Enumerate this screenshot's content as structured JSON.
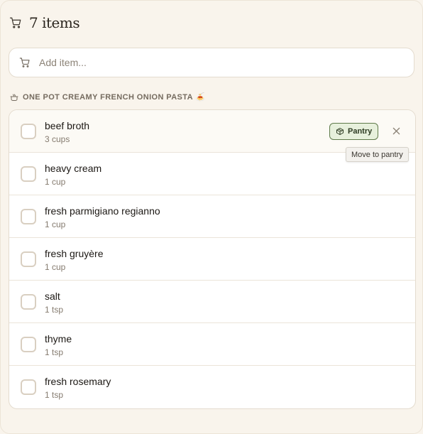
{
  "header": {
    "title": "7 items",
    "icon": "cart-icon"
  },
  "add_item": {
    "placeholder": "Add item...",
    "icon": "cart-icon"
  },
  "section": {
    "title": "ONE POT CREAMY FRENCH ONION PASTA 🍝",
    "icon": "pot-icon"
  },
  "items": [
    {
      "name": "beef broth",
      "qty": "3 cups"
    },
    {
      "name": "heavy cream",
      "qty": "1 cup"
    },
    {
      "name": "fresh parmigiano regianno",
      "qty": "1 cup"
    },
    {
      "name": "fresh gruyère",
      "qty": "1 cup"
    },
    {
      "name": "salt",
      "qty": "1 tsp"
    },
    {
      "name": "thyme",
      "qty": "1 tsp"
    },
    {
      "name": "fresh rosemary",
      "qty": "1 tsp"
    }
  ],
  "row_actions": {
    "pantry_label": "Pantry",
    "pantry_icon": "box-icon",
    "remove_icon": "close-icon",
    "tooltip": "Move to pantry"
  },
  "colors": {
    "background": "#f9f4ec",
    "pantry_accent": "#5f7a4a",
    "pantry_fill": "#e7f0dc"
  }
}
